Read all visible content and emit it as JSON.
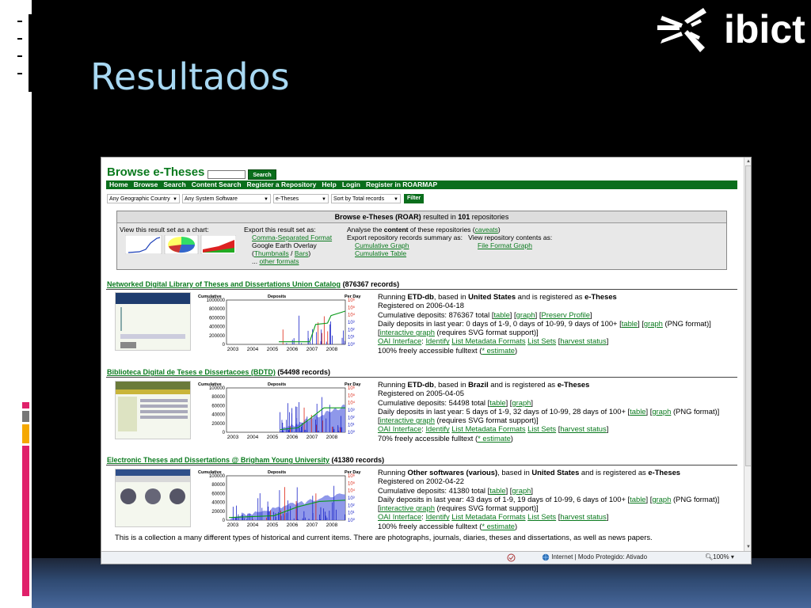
{
  "slide": {
    "title": "Resultados",
    "logo_text": "ibict",
    "colors": {
      "background": "#000000",
      "title": "#a8d8f2",
      "band": "#3b5a8a",
      "bar_pink": "#e0216a",
      "bar_gray": "#777777",
      "bar_orange": "#f5a800"
    }
  },
  "site": {
    "title": "Browse e-Theses",
    "search_button": "Search",
    "nav": [
      "Home",
      "Browse",
      "Search",
      "Content Search",
      "Register a Repository",
      "Help",
      "Login",
      "Register in ROARMAP"
    ],
    "filters": {
      "country": "Any Geographic Country",
      "software": "Any System Software",
      "type": "e-Theses",
      "sort": "Sort by Total records",
      "button": "Filter"
    }
  },
  "summary": {
    "title": "Browse e-Theses (ROAR)",
    "resulted_in": "resulted in",
    "count": "101",
    "repositories": "repositories",
    "chart_label": "View this result set as a chart:",
    "export_label": "Export this result set as:",
    "export_csv": "Comma-Separated Format",
    "export_google": "Google Earth Overlay",
    "export_thumbnails": "Thumbnails",
    "export_bars": "Bars",
    "export_other": "other formats",
    "analyse_label_pre": "Analyse the",
    "analyse_content": "content",
    "analyse_label_post": "of these repositories",
    "caveats": "caveats",
    "export_summary_label": "Export repository records summary as:",
    "cumulative_graph": "Cumulative Graph",
    "cumulative_table": "Cumulative Table",
    "view_contents_label": "View repository contents as:",
    "file_format_graph": "File Format Graph"
  },
  "records": [
    {
      "name": "Networked Digital Library of Theses and Dissertations Union Catalog",
      "count_text": "(876367 records)",
      "software": "ETD-db",
      "country": "United States",
      "type": "e-Theses",
      "registered": "Registered on 2006-04-18",
      "cumulative_text": "Cumulative deposits: 876367 total",
      "extra_link": "Preserv Profile",
      "daily_text": "Daily deposits in last year: 0 days of 1-9, 0 days of 10-99, 9 days of 100+",
      "fulltext": "100% freely accessible fulltext",
      "chart": {
        "cum_ticks": [
          "1000000",
          "800000",
          "600000",
          "400000",
          "200000",
          "0"
        ]
      }
    },
    {
      "name": "Biblioteca Digital de Teses e Dissertacoes (BDTD)",
      "count_text": "(54498 records)",
      "software": "ETD-db",
      "country": "Brazil",
      "type": "e-Theses",
      "registered": "Registered on 2005-04-05",
      "cumulative_text": "Cumulative deposits: 54498 total",
      "daily_text": "Daily deposits in last year: 5 days of 1-9, 32 days of 10-99, 28 days of 100+",
      "fulltext": "70% freely accessible fulltext",
      "chart": {
        "cum_ticks": [
          "100000",
          "80000",
          "60000",
          "40000",
          "20000",
          "0"
        ]
      }
    },
    {
      "name": "Electronic Theses and Dissertations @ Brigham Young University",
      "count_text": "(41380 records)",
      "software": "Other softwares (various)",
      "country": "United States",
      "type": "e-Theses",
      "registered": "Registered on 2002-04-22",
      "cumulative_text": "Cumulative deposits: 41380 total",
      "daily_text": "Daily deposits in last year: 43 days of 1-9, 19 days of 10-99, 6 days of 100+",
      "fulltext": "100% freely accessible fulltext",
      "description": "This is a collection a many different types of historical and current items. There are photographs, journals, diaries, theses and dissertations, as well as news papers.",
      "chart": {
        "cum_ticks": [
          "100000",
          "80000",
          "60000",
          "40000",
          "20000",
          "0"
        ]
      }
    }
  ],
  "record_common": {
    "running": "Running",
    "based_in": ", based in",
    "registered_as": "and is registered as",
    "table": "table",
    "graph": "graph",
    "png_format": "(PNG format)",
    "interactive_graph": "interactive graph",
    "svg_note": "(requires SVG format support)",
    "oai": "OAI Interface",
    "identify": "Identify",
    "list_formats": "List Metadata Formats",
    "list_sets": "List Sets",
    "harvest": "harvest status",
    "estimate": "* estimate",
    "chart_cumulative": "Cumulative",
    "chart_deposits": "Deposits",
    "chart_perday": "Per Day",
    "years": [
      "2003",
      "2004",
      "2005",
      "2006",
      "2007",
      "2008"
    ],
    "log_ticks": [
      "10⁶",
      "10⁵",
      "10⁴",
      "10³",
      "10²",
      "10¹",
      "10⁰"
    ]
  },
  "statusbar": {
    "zone": "Internet | Modo Protegido: Ativado",
    "zoom": "100%"
  }
}
